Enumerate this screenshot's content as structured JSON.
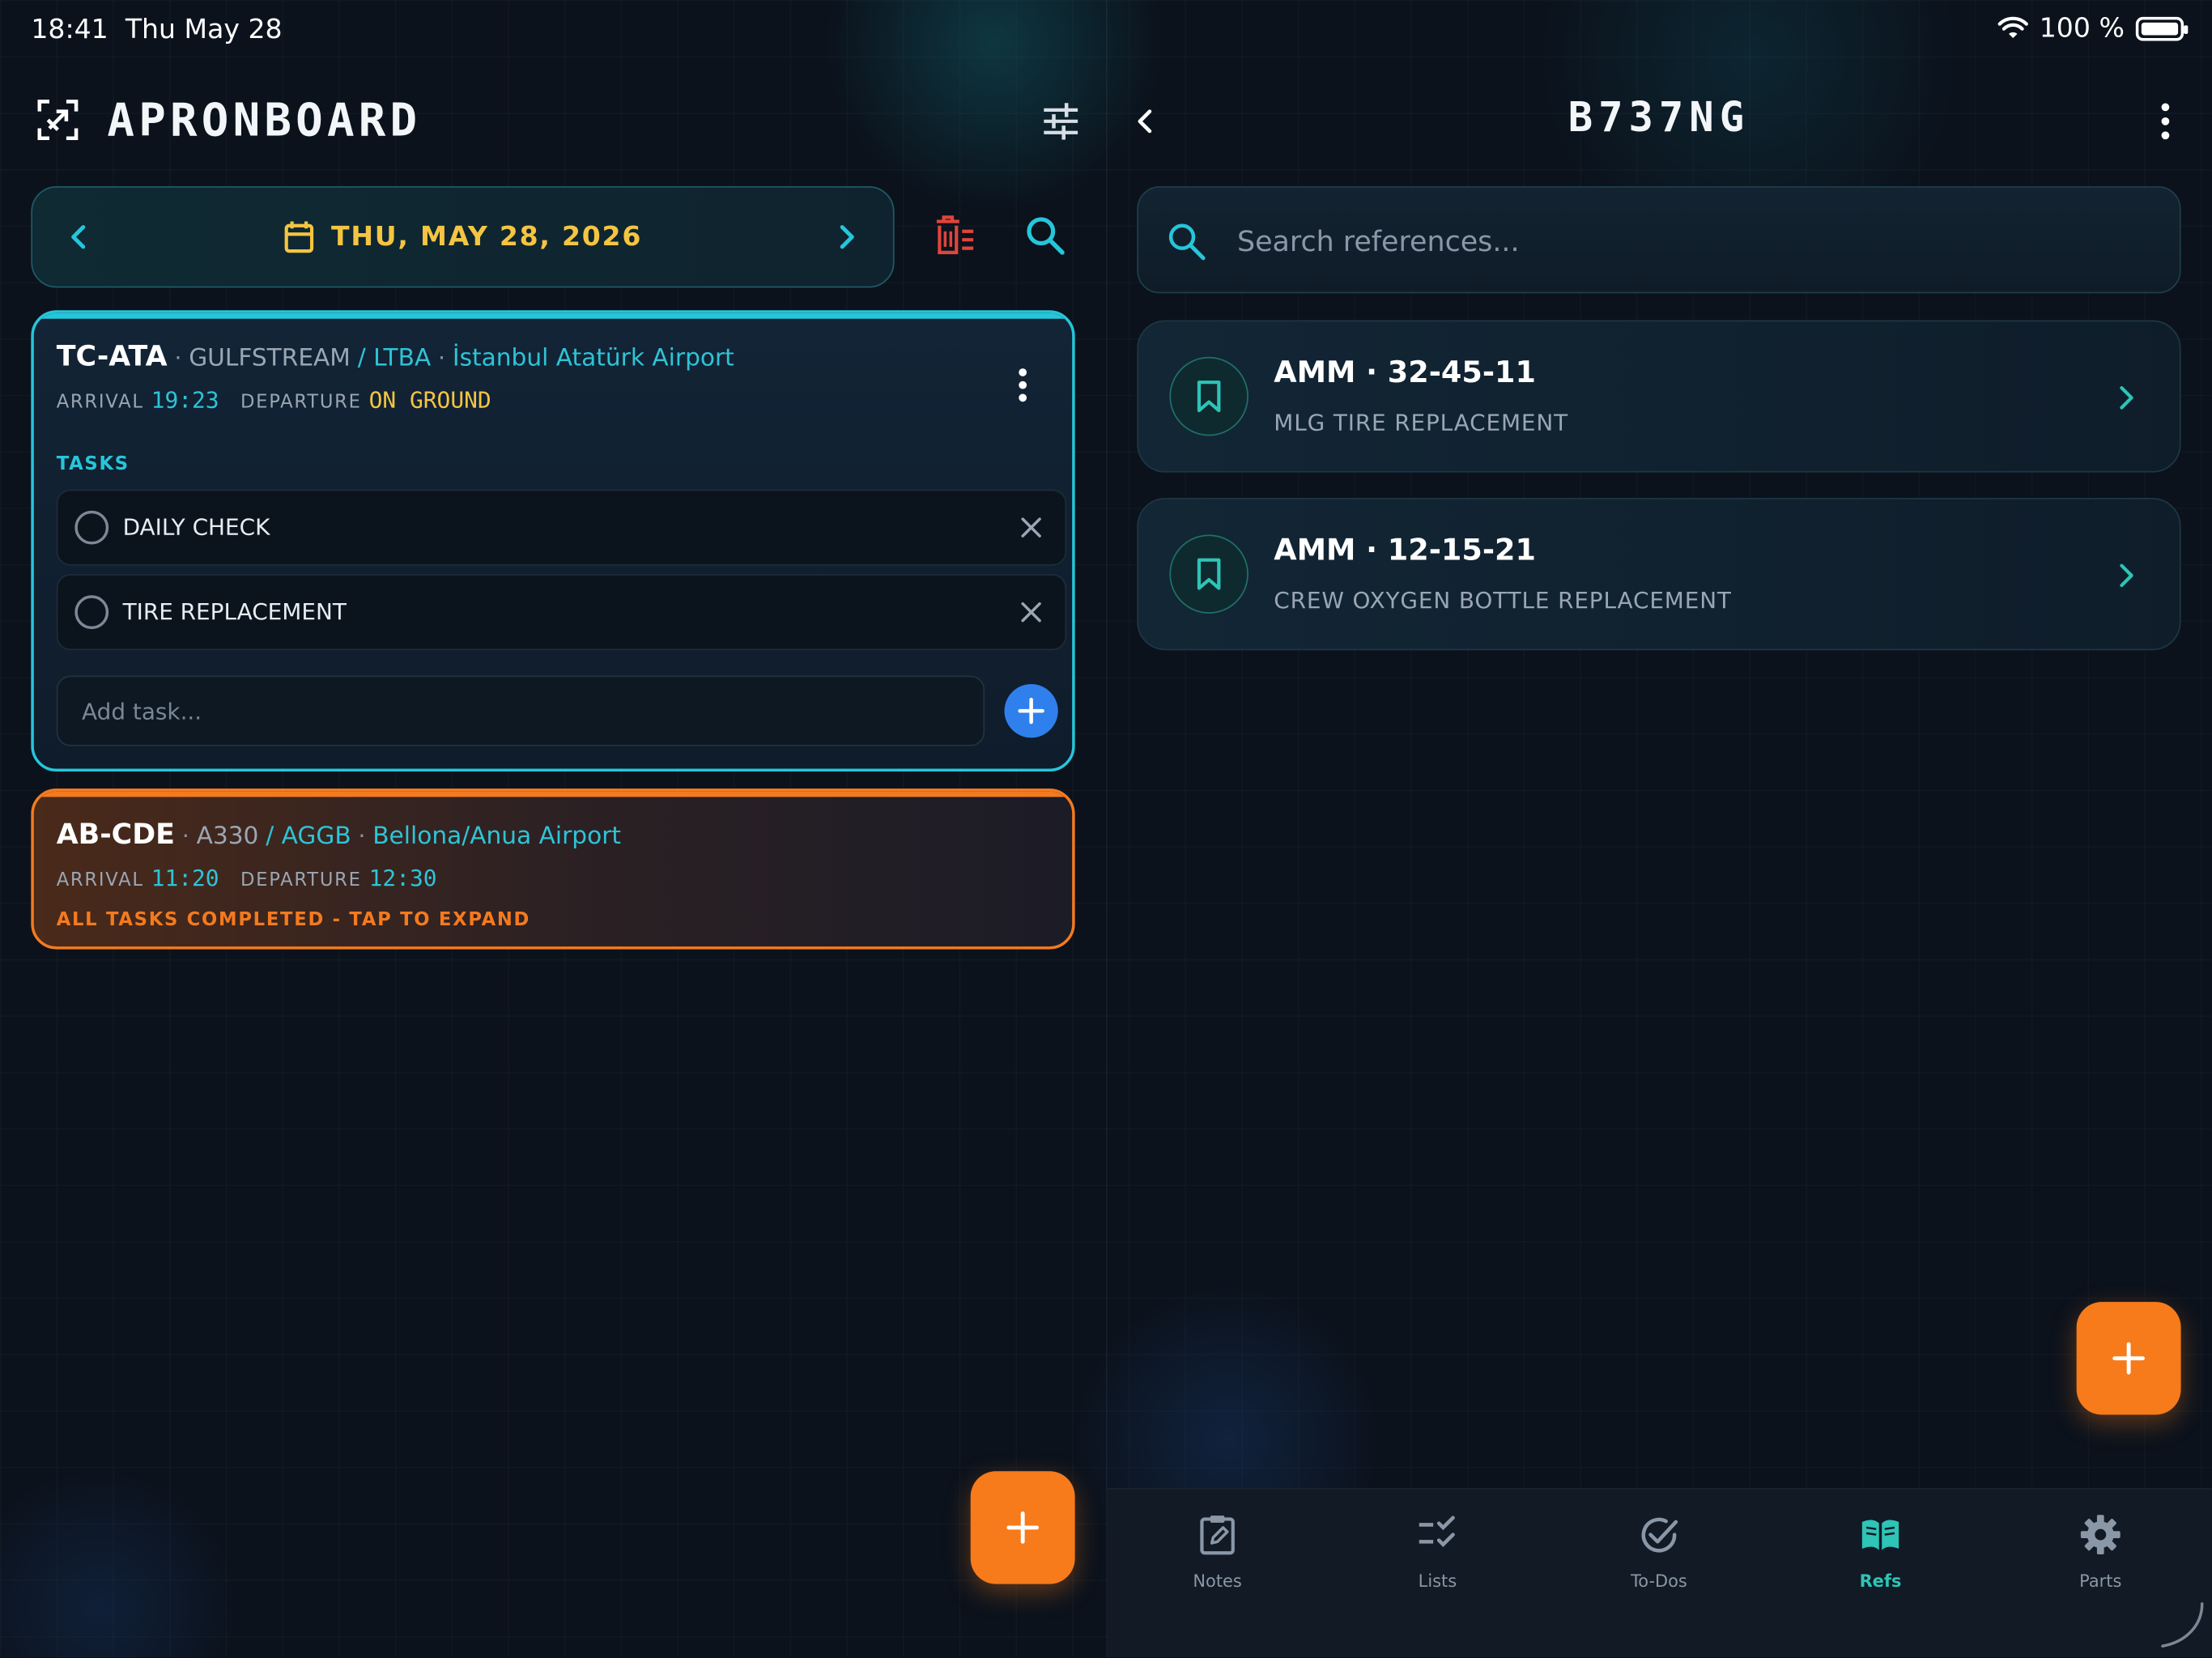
{
  "status_bar": {
    "time": "18:41",
    "date": "Thu May 28",
    "battery": "100 %"
  },
  "left": {
    "app_title": "APRONBOARD",
    "date_label": "THU, MAY 28, 2026",
    "flights": [
      {
        "registration": "TC-ATA",
        "aircraft": "GULFSTREAM",
        "airport_code": "LTBA",
        "airport_name": "İstanbul Atatürk Airport",
        "arrival_label": "ARRIVAL",
        "arrival": "19:23",
        "departure_label": "DEPARTURE",
        "departure": "ON GROUND",
        "tasks_heading": "TASKS",
        "tasks": [
          "DAILY CHECK",
          "TIRE REPLACEMENT"
        ],
        "add_task_placeholder": "Add task..."
      },
      {
        "registration": "AB-CDE",
        "aircraft": "A330",
        "airport_code": "AGGB",
        "airport_name": "Bellona/Anua Airport",
        "arrival_label": "ARRIVAL",
        "arrival": "11:20",
        "departure_label": "DEPARTURE",
        "departure": "12:30",
        "status": "ALL TASKS COMPLETED - TAP TO EXPAND"
      }
    ]
  },
  "right": {
    "title": "B737NG",
    "search_placeholder": "Search references...",
    "references": [
      {
        "title": "AMM · 32-45-11",
        "subtitle": "MLG TIRE REPLACEMENT"
      },
      {
        "title": "AMM · 12-15-21",
        "subtitle": "CREW OXYGEN BOTTLE REPLACEMENT"
      }
    ],
    "tabs": [
      {
        "label": "Notes",
        "icon": "notes-icon"
      },
      {
        "label": "Lists",
        "icon": "checklist-icon"
      },
      {
        "label": "To-Dos",
        "icon": "check-circle-icon"
      },
      {
        "label": "Refs",
        "icon": "book-icon",
        "active": true
      },
      {
        "label": "Parts",
        "icon": "gear-icon"
      }
    ]
  },
  "colors": {
    "accent_cyan": "#26c6da",
    "accent_orange": "#f77a1b",
    "accent_yellow": "#f4c542",
    "accent_blue": "#2f80ed",
    "danger_red": "#e0453a",
    "background": "#0b121c"
  }
}
